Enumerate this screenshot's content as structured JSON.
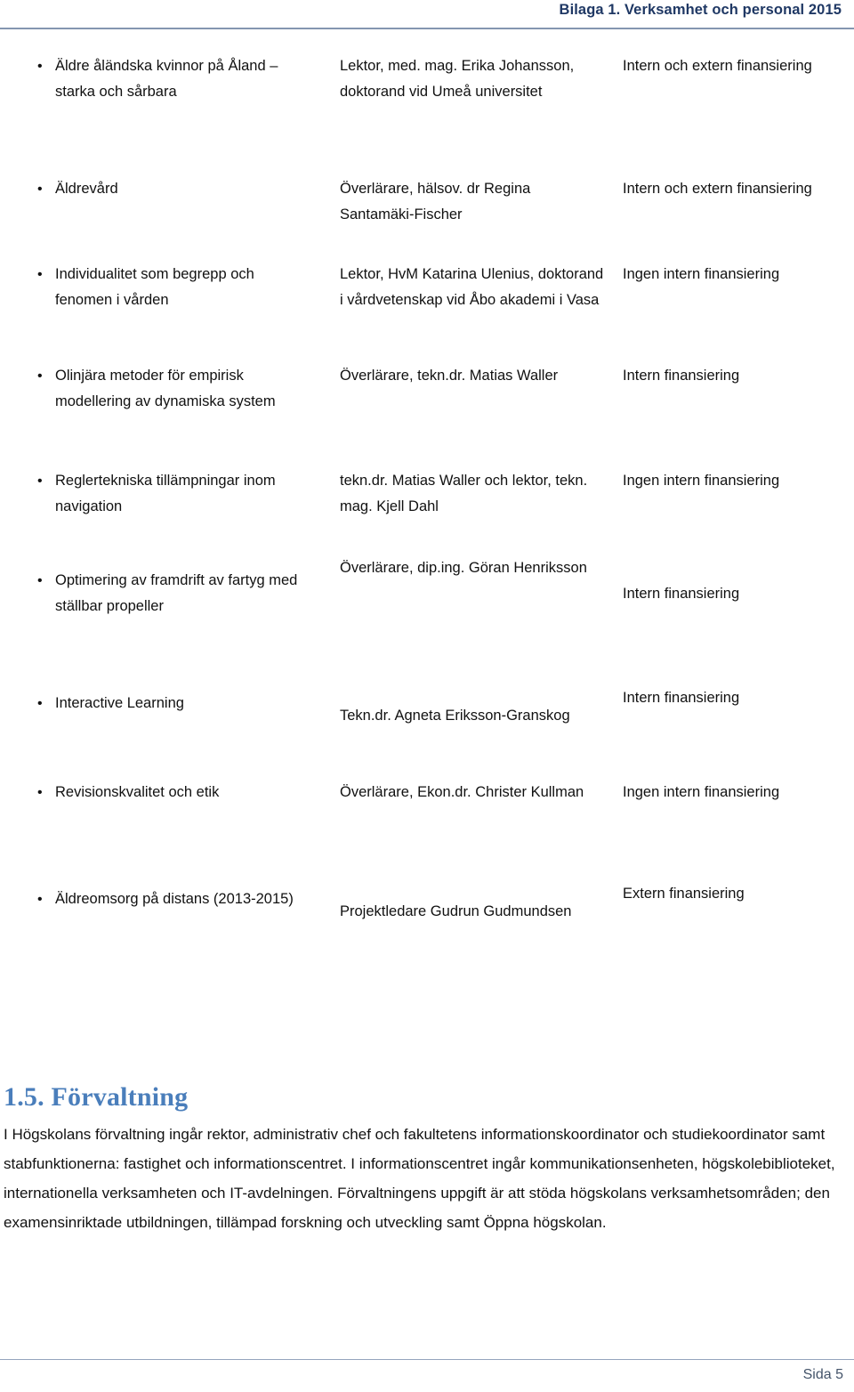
{
  "header": {
    "title": "Bilaga 1. Verksamhet och personal 2015"
  },
  "table": {
    "bullet_glyph": "•",
    "rows": [
      {
        "topic": "Äldre åländska kvinnor på Åland – starka och sårbara",
        "person": "Lektor, med. mag. Erika Johansson, doktorand vid Umeå universitet",
        "funding": "Intern och extern finansiering"
      },
      {
        "topic": "Äldrevård",
        "person": "Överlärare, hälsov. dr Regina Santamäki-Fischer",
        "funding": "Intern och extern finansiering"
      },
      {
        "topic": "Individualitet som begrepp och fenomen i vården",
        "person": "Lektor, HvM Katarina Ulenius, doktorand i vårdvetenskap vid Åbo akademi i Vasa",
        "funding": "Ingen intern finansiering"
      },
      {
        "topic": "Olinjära metoder för empirisk modellering av dynamiska system",
        "person": "Överlärare, tekn.dr. Matias Waller",
        "funding": "Intern finansiering"
      },
      {
        "topic": "Reglertekniska tillämpningar inom navigation",
        "person": "tekn.dr. Matias Waller och lektor, tekn. mag. Kjell Dahl",
        "funding": "Ingen intern finansiering"
      },
      {
        "topic": "Optimering av framdrift av fartyg med ställbar propeller",
        "person": "Överlärare, dip.ing. Göran Henriksson",
        "funding": "Intern finansiering"
      },
      {
        "topic": "Interactive Learning",
        "person": "Tekn.dr. Agneta Eriksson-Granskog",
        "funding": "Intern finansiering"
      },
      {
        "topic": "Revisionskvalitet och etik",
        "person": "Överlärare, Ekon.dr. Christer Kullman",
        "funding": "Ingen intern finansiering"
      },
      {
        "topic": "Äldreomsorg på distans (2013-2015)",
        "person": "Projektledare Gudrun Gudmundsen",
        "funding": "Extern finansiering"
      }
    ]
  },
  "section": {
    "heading": "1.5. Förvaltning",
    "paragraph": "I Högskolans förvaltning ingår rektor, administrativ chef och fakultetens informationskoordinator och studiekoordinator samt stabfunktionerna: fastighet och informationscentret. I informationscentret ingår kommunikationsenheten, högskolebiblioteket, internationella verksamheten och IT-avdelningen. Förvaltningens uppgift är att stöda högskolans verksamhetsområden; den examensinriktade utbildningen, tillämpad forskning och utveckling samt Öppna högskolan."
  },
  "footer": {
    "page_label": "Sida 5"
  },
  "colors": {
    "header_blue": "#1f3864",
    "rule_blue": "#8496b0",
    "heading_blue": "#4a7ebb",
    "footer_text": "#44546a",
    "body_text": "#111111"
  }
}
